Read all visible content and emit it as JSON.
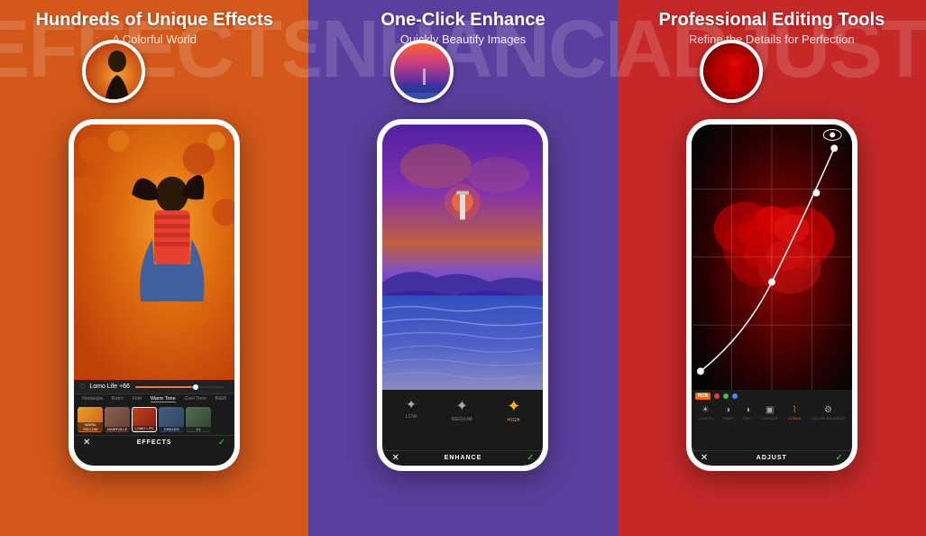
{
  "panels": [
    {
      "id": "effects",
      "bg_text": "EFFECTS",
      "title": "Hundreds of Unique Effects",
      "subtitle": "A Colorful World",
      "bg_color": "#D4581A",
      "circle_preview_label": "girl-preview",
      "filter_bar": {
        "heart_icon": "♡",
        "filter_name": "Lomo Life",
        "value": "+66"
      },
      "filter_tabs": [
        "Nostalgia",
        "Retro",
        "Film",
        "Warm Tone",
        "Cool Tone",
        "B&W"
      ],
      "active_tab": "Warm Tone",
      "filter_thumbs": [
        {
          "label": "WARM YELLOW",
          "color": "#E8821A"
        },
        {
          "label": "NASHVILLE",
          "color": "#8B6050"
        },
        {
          "label": "LOMO LIFE",
          "color": "#C04020"
        },
        {
          "label": "CHILLED",
          "color": "#406080"
        },
        {
          "label": "L1",
          "color": "#507050"
        }
      ],
      "bottom_actions": {
        "cancel": "✕",
        "label": "EFFECTS",
        "confirm": "✓"
      }
    },
    {
      "id": "enhance",
      "bg_text": "ENHANCE",
      "title": "One-Click Enhance",
      "subtitle": "Quickly Beautify Images",
      "bg_color": "#5B3F9E",
      "circle_preview_label": "sunset-preview",
      "enhance_options": [
        {
          "icon": "✦",
          "label": "LOW",
          "active": false
        },
        {
          "icon": "✦",
          "label": "MEDIUM",
          "active": false
        },
        {
          "icon": "✦",
          "label": "HIGH",
          "active": true
        }
      ],
      "bottom_actions": {
        "cancel": "✕",
        "label": "ENHANCE",
        "confirm": "✓"
      }
    },
    {
      "id": "adjust",
      "bg_text": "ADJUST",
      "title": "Professional Editing Tools",
      "subtitle": "Refine the Details for Perfection",
      "bg_color": "#C62828",
      "circle_preview_label": "roses-preview",
      "rgb_options": [
        {
          "label": "RGB",
          "color": "#FF6600"
        },
        {
          "dot_color": "#FF3333"
        },
        {
          "dot_color": "#44BB44"
        },
        {
          "dot_color": "#4488FF"
        }
      ],
      "adjust_tools": [
        {
          "icon": "☀",
          "label": "LIGHTS",
          "active": false
        },
        {
          "icon": "◑",
          "label": "TEMP",
          "active": false
        },
        {
          "icon": "◑",
          "label": "TINT",
          "active": false
        },
        {
          "icon": "▣",
          "label": "DEHAZE",
          "active": false
        },
        {
          "icon": "⌇",
          "label": "CURVE",
          "active": true
        },
        {
          "icon": "⚙",
          "label": "COLOR BALANCE",
          "active": false
        }
      ],
      "bottom_actions": {
        "cancel": "✕",
        "label": "ADJUST",
        "confirm": "✓"
      }
    }
  ]
}
